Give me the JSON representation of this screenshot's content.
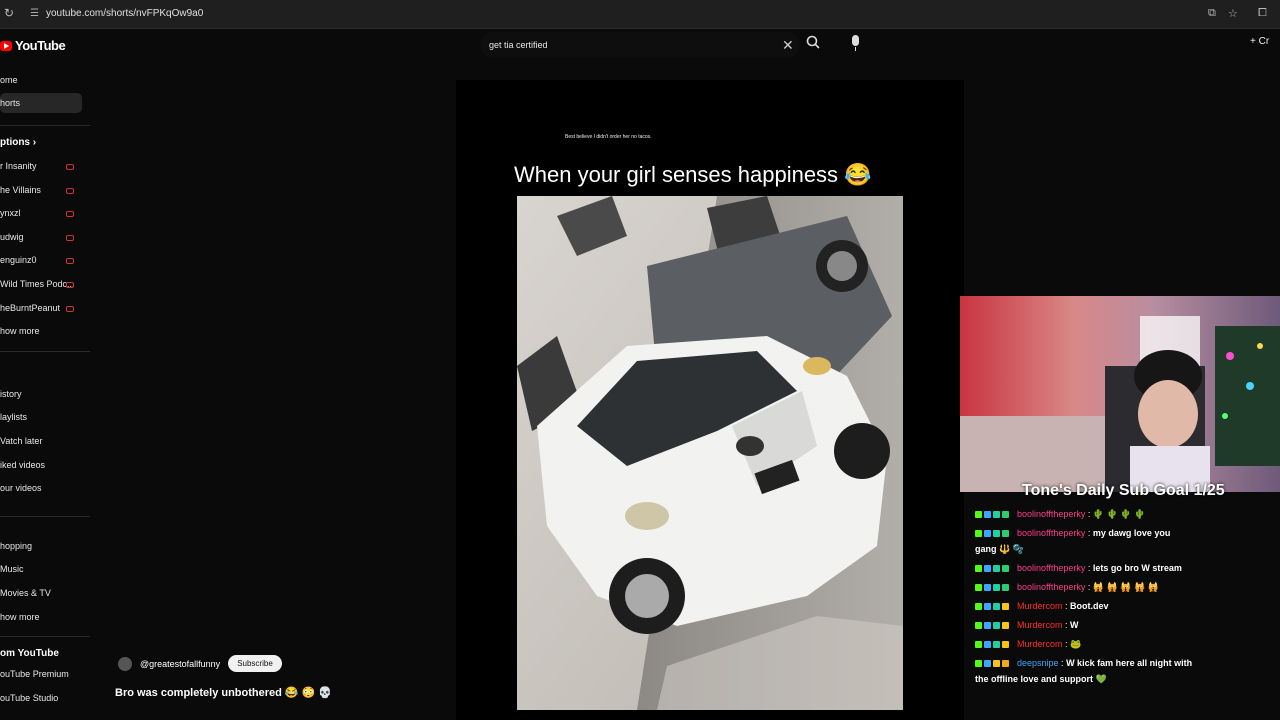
{
  "browser": {
    "url": "youtube.com/shorts/nvFPKqOw9a0"
  },
  "yt": {
    "logo_text": "YouTube"
  },
  "sidebar": {
    "home": "ome",
    "shorts": "horts",
    "subscriptions_head": "ptions",
    "subs": [
      "r Insanity",
      "he Villains",
      "ynxzl",
      "udwig",
      "enguinz0",
      "Wild Times Podc...",
      "heBurntPeanut"
    ],
    "show_more": "how more",
    "you": [
      "istory",
      "laylists",
      "Vatch later",
      "iked videos",
      "our videos"
    ],
    "explore": [
      "hopping",
      "Music",
      "Movies & TV"
    ],
    "show_more2": "how more",
    "from_yt_head": "om YouTube",
    "from_yt": [
      "ouTube Premium",
      "ouTube Studio"
    ]
  },
  "search": {
    "query": "get tia certified"
  },
  "header": {
    "create": "Cr"
  },
  "short": {
    "caption_small": "Best believe I didn't order her no tacos.",
    "caption_big": "When your girl senses happiness 😂",
    "channel": "@greatestofallfunny",
    "subscribe": "Subscribe",
    "title": "Bro was completely unbothered 😂 😳 💀"
  },
  "stream": {
    "goal": "Tone's Daily Sub Goal 1/25",
    "chat": [
      {
        "user": "boolinofftheperky",
        "user_color": "#ff3b8a",
        "text": "🌵 🌵 🌵 🌵"
      },
      {
        "user": "boolinofftheperky",
        "user_color": "#ff3b8a",
        "text": "my dawg love you"
      },
      {
        "user": "",
        "user_color": "#ffffff",
        "text": "gang 🔱 🫧"
      },
      {
        "user": "boolinofftheperky",
        "user_color": "#ff3b8a",
        "text": "lets go bro W stream"
      },
      {
        "user": "boolinofftheperky",
        "user_color": "#ff3b8a",
        "text": "🙀 🙀 🙀 🙀 🙀"
      },
      {
        "user": "Murdercom",
        "user_color": "#ff2b2b",
        "text": "Boot.dev"
      },
      {
        "user": "Murdercom",
        "user_color": "#ff2b2b",
        "text": "W"
      },
      {
        "user": "Murdercom",
        "user_color": "#ff2b2b",
        "text": "🐸"
      },
      {
        "user": "deepsnipe",
        "user_color": "#3ea6ff",
        "text": "W kick fam here all night with"
      },
      {
        "user": "",
        "user_color": "#ffffff",
        "text": "the offline love and support 💚"
      }
    ]
  }
}
